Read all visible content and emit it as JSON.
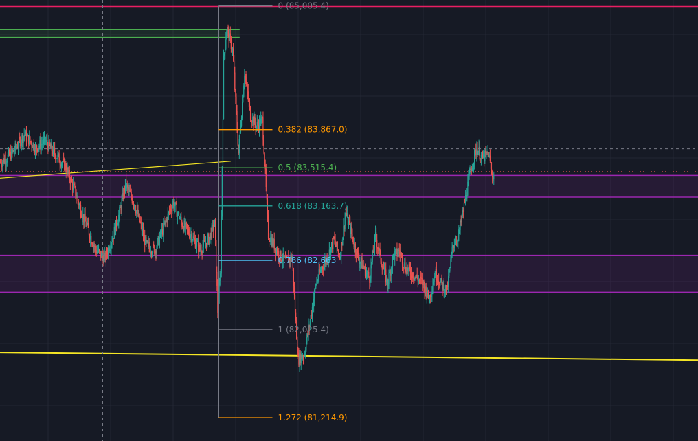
{
  "chart_data": {
    "type": "candlestick",
    "ylim": [
      81000,
      85060
    ],
    "x_count": 210,
    "colors": {
      "background": "#161a25",
      "grid": "#232734",
      "up": "#26a69a",
      "down": "#ef5350",
      "zone_purple": "#9c27b0",
      "zone_green": "#4caf50",
      "trend_yellow": "#f5e625",
      "top_line": "#e91e63",
      "crosshair": "#787b86"
    },
    "crosshair": {
      "x_index": 34,
      "price": 83690
    },
    "current_price_line": 83480,
    "zones": [
      {
        "name": "green-supply-zone",
        "top": 84790,
        "bottom": 84715,
        "from_index": 0,
        "to_index": 80,
        "color": "#4caf50"
      },
      {
        "name": "purple-zone-upper",
        "top": 83445,
        "bottom": 83245,
        "from_index": 0,
        "to_index": 210,
        "color": "#9c27b0"
      },
      {
        "name": "purple-zone-lower",
        "top": 82710,
        "bottom": 82370,
        "from_index": 0,
        "to_index": 210,
        "color": "#9c27b0"
      }
    ],
    "trendlines": [
      {
        "name": "rising-trendline",
        "p1": [
          0,
          83420
        ],
        "p2": [
          77,
          83575
        ],
        "color": "#f5e625"
      },
      {
        "name": "support-trendline",
        "p1": [
          0,
          81815
        ],
        "p2": [
          210,
          81745
        ],
        "color": "#f5e625"
      }
    ],
    "fibonacci": {
      "from_index": 73,
      "to_index": 91,
      "levels": [
        {
          "ratio": 0,
          "price": 85005.4,
          "label": "0 (85,005.4)",
          "color": "#787b86"
        },
        {
          "ratio": 0.382,
          "price": 83867.0,
          "label": "0.382 (83,867.0)",
          "color": "#ff9800"
        },
        {
          "ratio": 0.5,
          "price": 83515.4,
          "label": "0.5 (83,515.4)",
          "color": "#4caf50"
        },
        {
          "ratio": 0.618,
          "price": 83163.7,
          "label": "0.618 (83,163.7)",
          "color": "#26a69a"
        },
        {
          "ratio": 0.786,
          "price": 82663,
          "label": "0.786 (82,663",
          "color": "#4fc3f7"
        },
        {
          "ratio": 1,
          "price": 82025,
          "label": "1 (82,025.4)",
          "color": "#787b86"
        },
        {
          "ratio": 1.272,
          "price": 81214.9,
          "label": "1.272 (81,214.9)",
          "color": "#ff9800"
        }
      ]
    },
    "top_line_price": 85000,
    "anchors": [
      [
        0,
        83560
      ],
      [
        4,
        83650
      ],
      [
        8,
        83820
      ],
      [
        12,
        83700
      ],
      [
        15,
        83760
      ],
      [
        19,
        83620
      ],
      [
        22,
        83520
      ],
      [
        25,
        83300
      ],
      [
        28,
        83050
      ],
      [
        32,
        82760
      ],
      [
        35,
        82680
      ],
      [
        38,
        82900
      ],
      [
        40,
        83100
      ],
      [
        42,
        83360
      ],
      [
        45,
        83190
      ],
      [
        47,
        83000
      ],
      [
        49,
        82800
      ],
      [
        52,
        82760
      ],
      [
        55,
        82980
      ],
      [
        58,
        83200
      ],
      [
        61,
        83000
      ],
      [
        64,
        82900
      ],
      [
        67,
        82760
      ],
      [
        70,
        82860
      ],
      [
        72,
        83000
      ],
      [
        73,
        82200
      ],
      [
        74,
        82580
      ],
      [
        75,
        84500
      ],
      [
        76,
        84800
      ],
      [
        78,
        84600
      ],
      [
        80,
        83650
      ],
      [
        82,
        84400
      ],
      [
        84,
        84000
      ],
      [
        86,
        83900
      ],
      [
        88,
        83950
      ],
      [
        89,
        83450
      ],
      [
        90,
        82900
      ],
      [
        92,
        82800
      ],
      [
        94,
        82700
      ],
      [
        96,
        82650
      ],
      [
        98,
        82700
      ],
      [
        99,
        82200
      ],
      [
        100,
        81750
      ],
      [
        102,
        81800
      ],
      [
        104,
        82100
      ],
      [
        106,
        82450
      ],
      [
        108,
        82600
      ],
      [
        110,
        82700
      ],
      [
        112,
        82850
      ],
      [
        114,
        82700
      ],
      [
        116,
        83100
      ],
      [
        118,
        82900
      ],
      [
        120,
        82700
      ],
      [
        122,
        82600
      ],
      [
        124,
        82500
      ],
      [
        126,
        82880
      ],
      [
        128,
        82650
      ],
      [
        130,
        82450
      ],
      [
        132,
        82700
      ],
      [
        134,
        82750
      ],
      [
        136,
        82600
      ],
      [
        138,
        82550
      ],
      [
        140,
        82500
      ],
      [
        142,
        82450
      ],
      [
        144,
        82300
      ],
      [
        146,
        82550
      ],
      [
        148,
        82450
      ],
      [
        150,
        82380
      ],
      [
        152,
        82800
      ],
      [
        154,
        82900
      ],
      [
        156,
        83200
      ],
      [
        158,
        83500
      ],
      [
        160,
        83700
      ],
      [
        162,
        83600
      ],
      [
        164,
        83650
      ],
      [
        165,
        83450
      ]
    ]
  }
}
